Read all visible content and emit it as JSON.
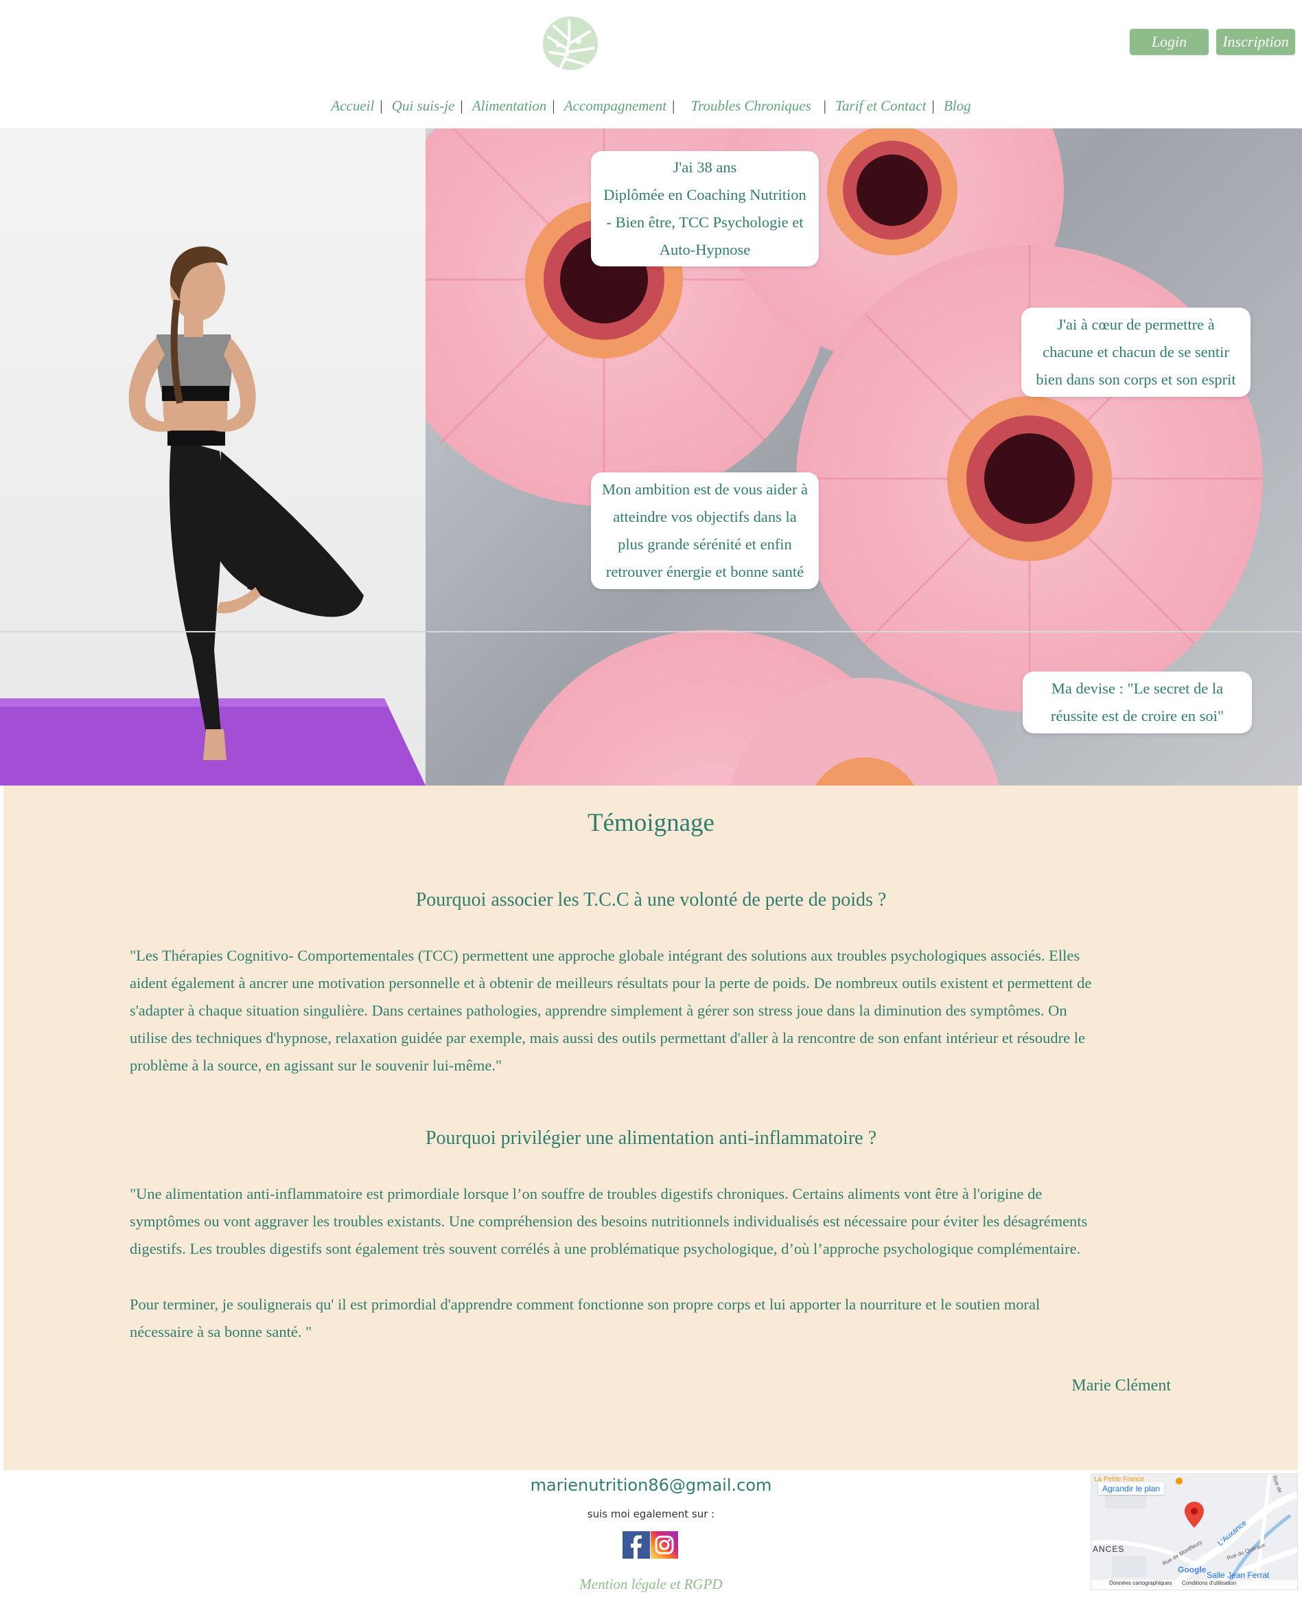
{
  "header": {
    "logo_icon": "monstera-leaf-icon",
    "login_label": "Login",
    "signup_label": "Inscription"
  },
  "nav": {
    "items": [
      "Accueil",
      "Qui suis-je",
      "Alimentation",
      "Accompagnement",
      "Troubles Chroniques",
      "Tarif et Contact",
      "Blog"
    ]
  },
  "hero": {
    "bubble1_lines": [
      "J'ai 38 ans",
      "Diplômée en Coaching Nutrition",
      "- Bien être, TCC Psychologie et",
      "Auto-Hypnose"
    ],
    "bubble2_lines": [
      "J'ai à cœur de permettre à",
      "chacune et chacun de se sentir",
      "bien dans son corps et son esprit"
    ],
    "bubble3_lines": [
      "Mon ambition est de vous aider à",
      "atteindre vos objectifs dans la",
      "plus grande sérénité et enfin",
      "retrouver énergie et bonne santé"
    ],
    "bubble4_lines": [
      "Ma devise : \"Le secret de la",
      "réussite est de croire en soi\""
    ]
  },
  "testimonial": {
    "title": "Témoignage",
    "q1": "Pourquoi associer les T.C.C à une volonté de perte de poids ?",
    "q1_lines": [
      "\"Les Thérapies Cognitivo- Comportementales (TCC) permettent une approche globale intégrant des solutions aux troubles psychologiques associés. Elles",
      "aident également à ancrer une motivation personnelle et à obtenir de meilleurs résultats pour la perte de poids. De nombreux outils existent et permettent de",
      "s'adapter à chaque situation singulière. Dans certaines pathologies, apprendre simplement à gérer son stress joue dans la diminution des symptômes. On",
      "utilise des techniques d'hypnose, relaxation guidée par exemple, mais aussi des outils permettant d'aller à la rencontre de son enfant intérieur et résoudre le",
      "problème à la source, en agissant sur le souvenir lui-même.\""
    ],
    "q2": "Pourquoi privilégier une alimentation anti-inflammatoire ?",
    "q2_lines": [
      "\"Une alimentation anti-inflammatoire est primordiale lorsque l’on souffre de troubles digestifs chroniques. Certains aliments vont être à l'origine de",
      "symptômes ou vont aggraver les troubles existants. Une compréhension des besoins nutritionnels individualisés est nécessaire pour éviter les désagréments",
      "digestifs. Les troubles digestifs sont également très souvent corrélés à une problématique psychologique, d’où l’approche psychologique complémentaire."
    ],
    "q2_closing_lines": [
      "Pour terminer, je soulignerais qu' il est primordial d'apprendre comment fonctionne son propre corps et lui apporter la nourriture et le soutien moral",
      "nécessaire à sa bonne santé. \""
    ],
    "signature": "Marie Clément"
  },
  "footer": {
    "email": "marienutrition86@gmail.com",
    "follow_text": "suis moi egalement sur :",
    "legal_link": "Mention légale et RGPD",
    "social_icons": [
      "facebook-icon",
      "instagram-icon"
    ]
  },
  "map": {
    "enlarge_label": "Agrandir le plan",
    "place_la_petite_france": "La Petite France",
    "label_ances": "ANCES",
    "label_lauxance": "L'Auxance",
    "label_salle": "Salle Jean Ferrat",
    "label_rue_queraux": "Rue du Quéraux",
    "label_rue_montfleury": "Rue de Montfleury",
    "label_rue": "Rue de",
    "credits_data": "Données cartographiques",
    "credits_terms": "Conditions d'utilisation",
    "google": "Google"
  },
  "colors": {
    "accent_green": "#2e7d6e",
    "button_green": "#8fbc8b",
    "testimonial_bg": "#f8ead7"
  }
}
